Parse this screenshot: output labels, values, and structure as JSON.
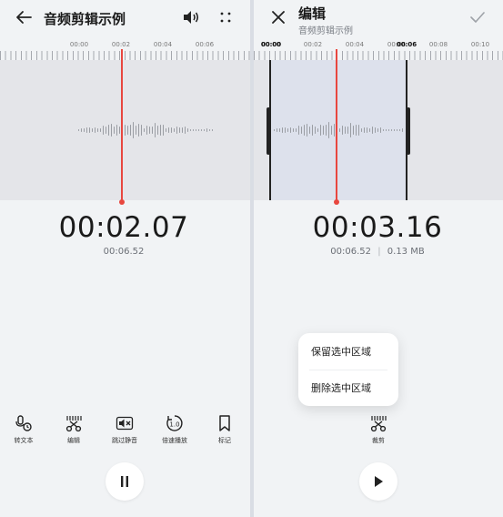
{
  "left_screen": {
    "title": "音频剪辑示例",
    "icons": {
      "back": "arrow-left-icon",
      "volume": "speaker-volume-icon",
      "menu": "four-dots-icon"
    },
    "ruler_labels": [
      "00:00",
      "00:02",
      "00:04",
      "00:06"
    ],
    "current_time": "00:02.07",
    "total_time": "00:06.52",
    "tools": [
      {
        "label": "转文本",
        "icon": "speech-to-text-icon"
      },
      {
        "label": "编辑",
        "icon": "scissors-edit-icon"
      },
      {
        "label": "跳过静音",
        "icon": "skip-silence-icon"
      },
      {
        "label": "倍速播放",
        "icon": "playback-speed-icon"
      },
      {
        "label": "标记",
        "icon": "bookmark-icon"
      }
    ],
    "play_control": "pause-icon"
  },
  "right_screen": {
    "title": "编辑",
    "subtitle": "音频剪辑示例",
    "icons": {
      "close": "close-icon",
      "confirm": "check-icon"
    },
    "ruler_labels": [
      "00:00",
      "00:02",
      "00:04",
      "00:06",
      "00:08",
      "00:10"
    ],
    "ruler_markers": [
      "00:00",
      "00:06"
    ],
    "current_time": "00:03.16",
    "total_time": "00:06.52",
    "file_size": "0.13 MB",
    "popup_menu": [
      "保留选中区域",
      "删除选中区域"
    ],
    "tool": {
      "label": "裁剪",
      "icon": "trim-scissors-icon"
    },
    "play_control": "play-icon"
  }
}
